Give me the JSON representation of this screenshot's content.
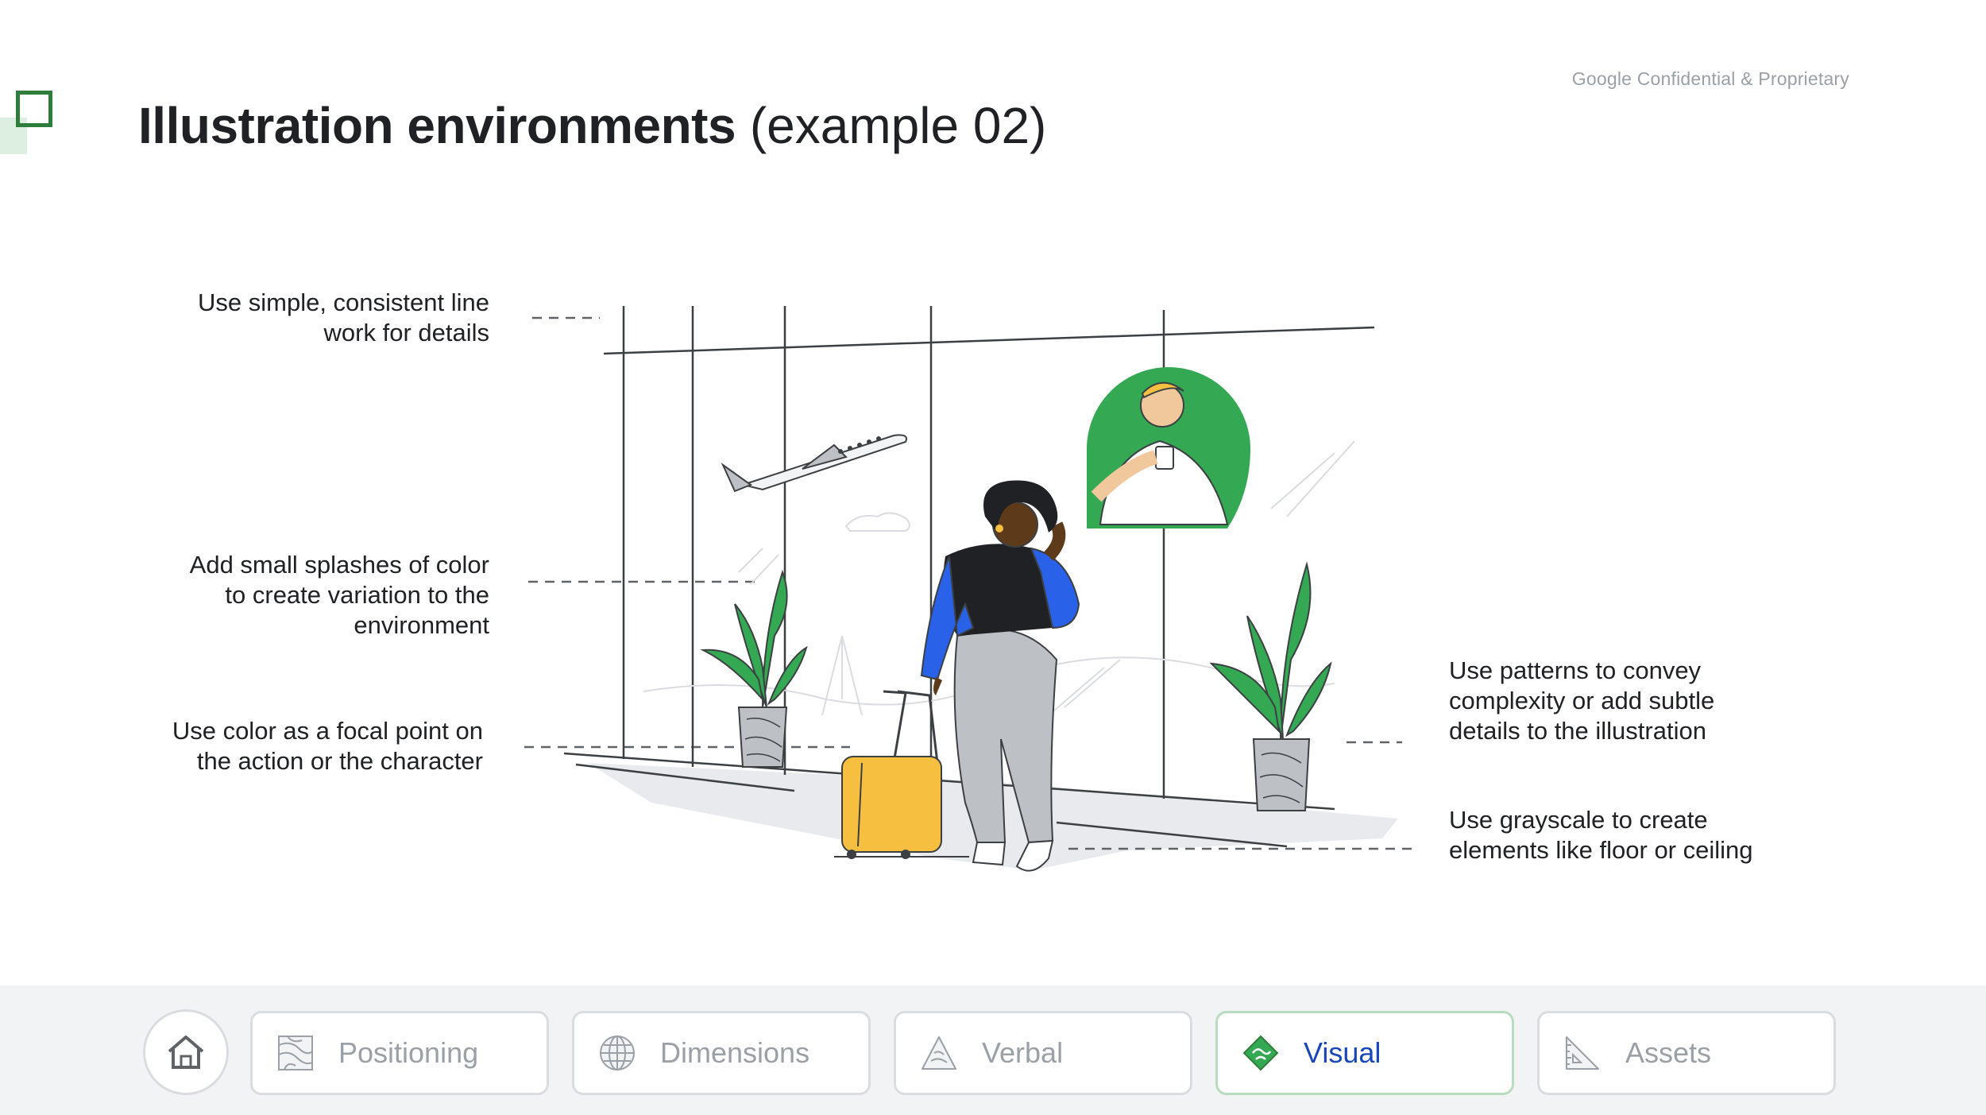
{
  "header": {
    "confidential": "Google Confidential & Proprietary",
    "title_bold": "Illustration environments",
    "title_light": "(example 02)"
  },
  "annotations": {
    "line_work": [
      "Use simple, consistent line",
      "work for details"
    ],
    "color_splashes": [
      "Add small splashes of color",
      "to create variation to the",
      "environment"
    ],
    "focal_point": [
      "Use color as a focal point on",
      "the action or the character"
    ],
    "patterns": [
      "Use patterns to convey",
      "complexity or add subtle",
      "details to the illustration"
    ],
    "grayscale": [
      "Use grayscale to create",
      "elements like floor or ceiling"
    ]
  },
  "nav": {
    "home_icon": "home-icon",
    "items": [
      {
        "label": "Positioning",
        "icon": "contour-map-icon",
        "active": false
      },
      {
        "label": "Dimensions",
        "icon": "globe-icon",
        "active": false
      },
      {
        "label": "Verbal",
        "icon": "triangle-icon",
        "active": false
      },
      {
        "label": "Visual",
        "icon": "diamond-icon",
        "active": true
      },
      {
        "label": "Assets",
        "icon": "ruler-triangle-icon",
        "active": false
      }
    ]
  },
  "colors": {
    "accent_green": "#34a853",
    "dark_green": "#2f7d3a",
    "blue": "#2962e8",
    "yellow": "#f6bf40",
    "active_label": "#1a47b8"
  }
}
